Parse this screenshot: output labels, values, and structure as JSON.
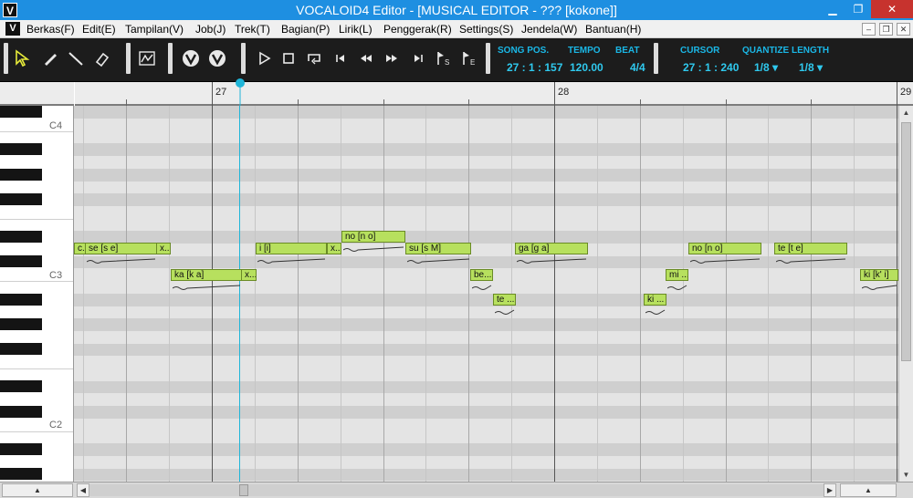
{
  "window": {
    "app_icon": "V",
    "title": "VOCALOID4 Editor - [MUSICAL EDITOR - ??? [kokone]]",
    "controls": {
      "minimize": "▁",
      "restore": "❐",
      "close": "✕"
    }
  },
  "menu": {
    "app_icon": "V",
    "items": [
      "Berkas(F)",
      "Edit(E)",
      "Tampilan(V)",
      "Job(J)",
      "Trek(T)",
      "Bagian(P)",
      "Lirik(L)",
      "Penggerak(R)",
      "Settings(S)",
      "Jendela(W)",
      "Bantuan(H)"
    ],
    "mdi_buttons": [
      "–",
      "❐",
      "✕"
    ]
  },
  "toolbar": {
    "tool_icons": [
      "arrow-tool-icon",
      "pencil-tool-icon",
      "line-tool-icon",
      "eraser-tool-icon",
      "envelope-tool-icon",
      "realtime-input-icon",
      "voice-convert-icon"
    ],
    "transport_icons": [
      "play-icon",
      "stop-icon",
      "loop-icon",
      "go-start-icon",
      "rewind-icon",
      "fast-forward-icon",
      "go-end-icon",
      "start-marker-icon",
      "end-marker-icon"
    ],
    "song_pos": {
      "label": "SONG POS.",
      "value": "27 : 1 : 157"
    },
    "tempo": {
      "label": "TEMPO",
      "value": "120.00"
    },
    "beat": {
      "label": "BEAT",
      "value": "4/4"
    },
    "cursor": {
      "label": "CURSOR",
      "value": "27 : 1 : 240"
    },
    "quantize": {
      "label": "QUANTIZE",
      "value": "1/8 ▾"
    },
    "length": {
      "label": "LENGTH",
      "value": "1/8 ▾"
    },
    "accent_color": "#1ab7e6"
  },
  "ruler": {
    "measures": [
      {
        "label": "27"
      },
      {
        "label": "28"
      },
      {
        "label": "29"
      }
    ]
  },
  "piano": {
    "octave_labels": [
      "C4",
      "C3",
      "C2"
    ]
  },
  "notes": [
    {
      "lyric": "c..."
    },
    {
      "lyric": "se [s e]"
    },
    {
      "lyric": "x..."
    },
    {
      "lyric": "ka [k a]"
    },
    {
      "lyric": "x..."
    },
    {
      "lyric": "i [i]"
    },
    {
      "lyric": "x..."
    },
    {
      "lyric": "no [n o]"
    },
    {
      "lyric": "su [s M]"
    },
    {
      "lyric": "be..."
    },
    {
      "lyric": "te ..."
    },
    {
      "lyric": "ga [g a]"
    },
    {
      "lyric": "ki ..."
    },
    {
      "lyric": "mi ..."
    },
    {
      "lyric": "no [n o]"
    },
    {
      "lyric": "te [t e]"
    },
    {
      "lyric": "ki [k' i]"
    }
  ],
  "colors": {
    "note_fill": "#b7e05e",
    "playhead": "#1fb5d8",
    "title_bar": "#1e8fe1"
  }
}
